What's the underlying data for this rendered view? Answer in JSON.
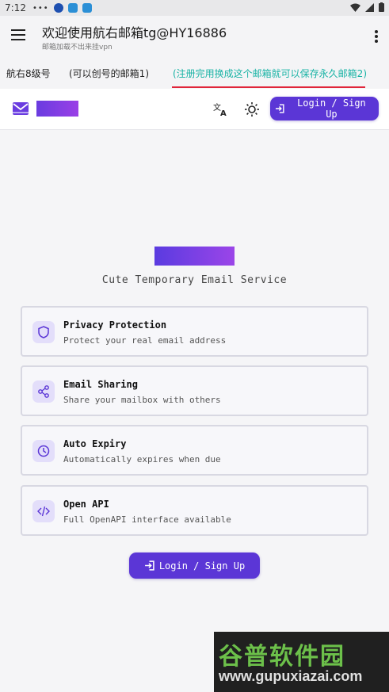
{
  "statusbar": {
    "time": "7:12",
    "dots": "•••"
  },
  "appbar": {
    "title": "欢迎使用航右邮箱tg@HY16886",
    "subtitle": "邮箱加载不出来挂vpn"
  },
  "tabs": [
    {
      "label": "航右8级号"
    },
    {
      "label": "(可以创号的邮箱1)"
    },
    {
      "label": "(注册完用换成这个邮箱就可以保存永久邮箱2)"
    }
  ],
  "header": {
    "login_label": "Login / Sign Up"
  },
  "hero": {
    "tagline": "Cute Temporary Email Service"
  },
  "features": [
    {
      "title": "Privacy Protection",
      "desc": "Protect your real email address",
      "icon": "shield-icon"
    },
    {
      "title": "Email Sharing",
      "desc": "Share your mailbox with others",
      "icon": "share-icon"
    },
    {
      "title": "Auto Expiry",
      "desc": "Automatically expires when due",
      "icon": "clock-icon"
    },
    {
      "title": "Open API",
      "desc": "Full OpenAPI interface available",
      "icon": "code-icon"
    }
  ],
  "cta": {
    "login_label": "Login / Sign Up"
  },
  "watermark": {
    "name": "谷普软件园",
    "url": "www.gupuxiazai.com"
  },
  "colors": {
    "accent": "#5b36d6",
    "active_tab": "#19b3a5",
    "tab_indicator": "#e0253a"
  }
}
